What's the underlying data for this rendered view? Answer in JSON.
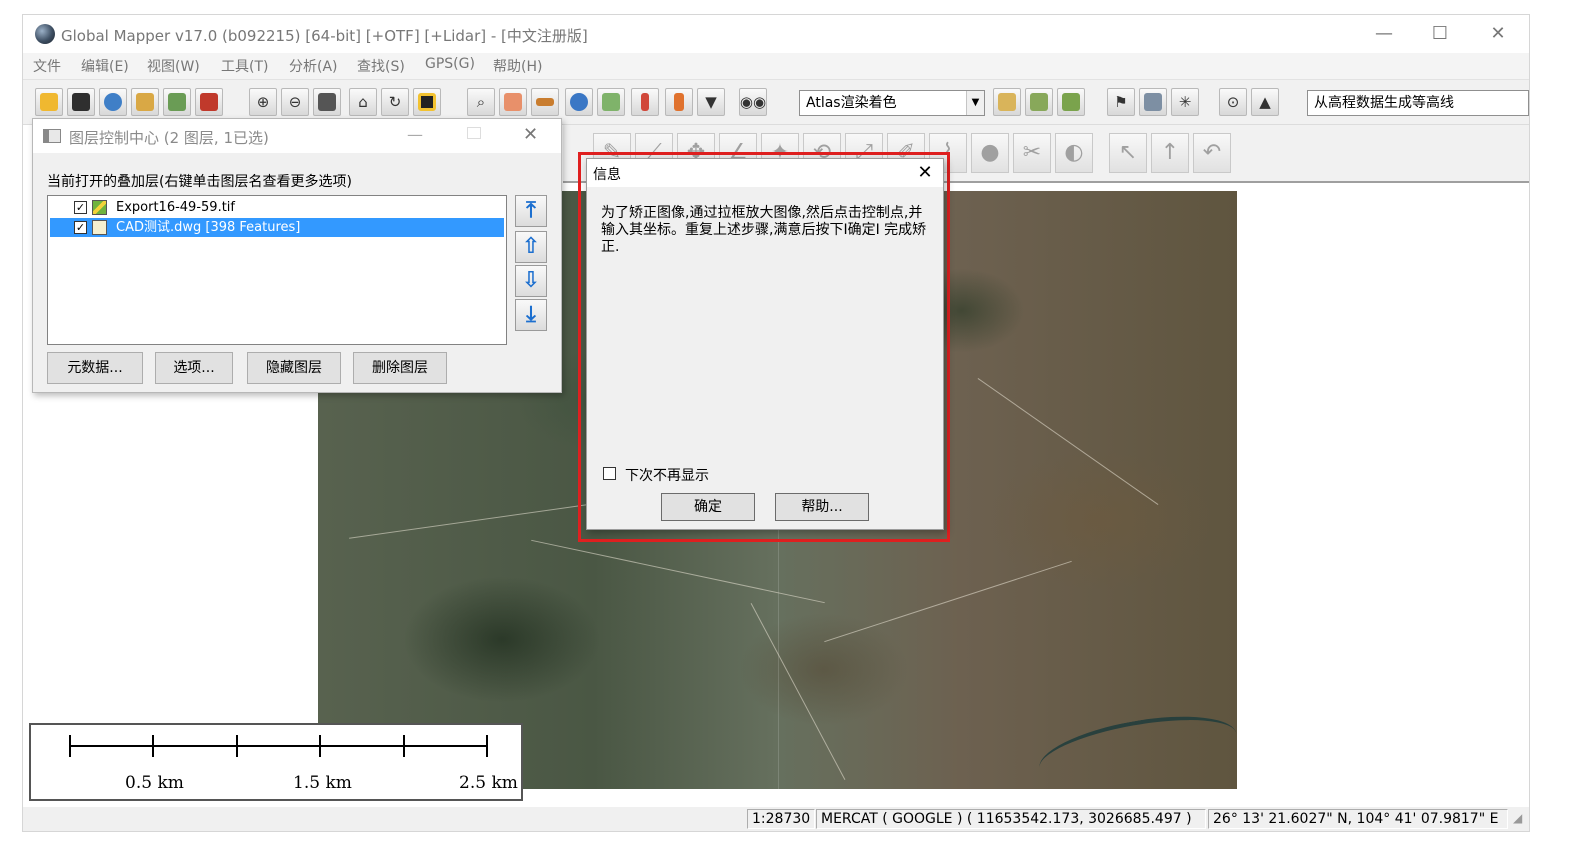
{
  "window": {
    "title": "Global Mapper v17.0 (b092215) [64-bit] [+OTF] [+Lidar] - [中文注册版]",
    "minimize": "—",
    "maximize": "☐",
    "close": "✕"
  },
  "menu": [
    "文件",
    "编辑(E)",
    "视图(W)",
    "工具(T)",
    "分析(A)",
    "查找(S)",
    "GPS(G)",
    "帮助(H)"
  ],
  "toolbar": {
    "shader_combo": "Atlas渲染着色",
    "command_combo": "从高程数据生成等高线",
    "icons": [
      "open-folder-icon",
      "save-icon",
      "globe-icon",
      "layers-icon",
      "export-icon",
      "tools-icon",
      "zoom-in-icon",
      "zoom-out-icon",
      "zoom-box-icon",
      "home-icon",
      "refresh-icon",
      "grid-icon",
      "select-icon",
      "pan-icon",
      "measure-icon",
      "info-icon",
      "edit-icon",
      "pin-icon",
      "pen-icon",
      "dropdown-icon",
      "binoculars-icon"
    ]
  },
  "layer_control": {
    "title": "图层控制中心 (2 图层, 1已选)",
    "caption": "当前打开的叠加层(右键单击图层名查看更多选项)",
    "layers": [
      {
        "name": "Export16-49-59.tif",
        "checked": true,
        "selected": false
      },
      {
        "name": "CAD测试.dwg [398 Features]",
        "checked": true,
        "selected": true
      }
    ],
    "buttons": {
      "metadata": "元数据...",
      "options": "选项...",
      "hide": "隐藏图层",
      "delete": "删除图层"
    },
    "minimize": "—",
    "close": "✕"
  },
  "dialog": {
    "title": "信息",
    "close": "✕",
    "message": "为了矫正图像,通过拉框放大图像,然后点击控制点,并输入其坐标。重复上述步骤,满意后按下I确定I 完成矫正.",
    "checkbox_label": "下次不再显示",
    "ok": "确定",
    "help": "帮助..."
  },
  "scalebar": {
    "labels": [
      "0.5 km",
      "1.5 km",
      "2.5 km"
    ]
  },
  "status": {
    "scale": "1:28730",
    "projection": "MERCAT ( GOOGLE ) ( 11653542.173, 3026685.497 )",
    "latlon": "26° 13' 21.6027\" N, 104° 41' 07.9817\" E"
  },
  "colors": {
    "highlight": "#e02020",
    "selection": "#3399ff",
    "arrow_blue": "#1c6fcf"
  }
}
